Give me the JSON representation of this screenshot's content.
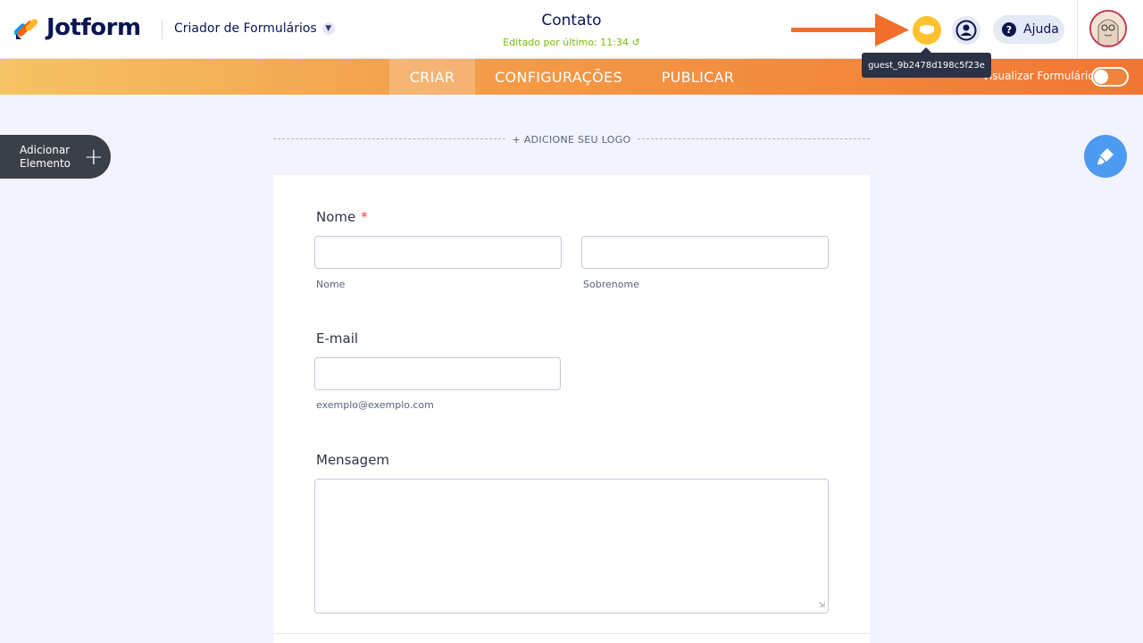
{
  "header": {
    "brand": "Jotform",
    "builder_label": "Criador de Formulários",
    "form_title": "Contato",
    "edited_text": "Editado por último: 11:34",
    "help_label": "Ajuda",
    "guest_tooltip": "guest_9b2478d198c5f23e"
  },
  "nav": {
    "tabs": [
      {
        "label": "CRIAR",
        "active": true
      },
      {
        "label": "CONFIGURAÇÕES",
        "active": false
      },
      {
        "label": "PUBLICAR",
        "active": false
      }
    ],
    "preview_label": "Visualizar Formulário",
    "preview_toggle_on": false
  },
  "sidebar": {
    "add_element_line1": "Adicionar",
    "add_element_line2": "Elemento"
  },
  "form": {
    "add_logo": "+ ADICIONE SEU LOGO",
    "name_label": "Nome",
    "name_required": "*",
    "first_sublabel": "Nome",
    "last_sublabel": "Sobrenome",
    "email_label": "E-mail",
    "email_sublabel": "exemplo@exemplo.com",
    "message_label": "Mensagem"
  },
  "colors": {
    "accent_orange": "#f17634",
    "brand_navy": "#0a1551",
    "guest_yellow": "#ffc22d",
    "paint_blue": "#4d9af1",
    "edited_green": "#78bb07"
  },
  "icons": [
    "jotform-logo-icon",
    "chevron-down-icon",
    "undo-icon",
    "arrow-right-icon",
    "guest-icon",
    "user-icon",
    "help-icon",
    "avatar",
    "plus-icon",
    "paint-brush-icon",
    "resize-handle-icon"
  ]
}
